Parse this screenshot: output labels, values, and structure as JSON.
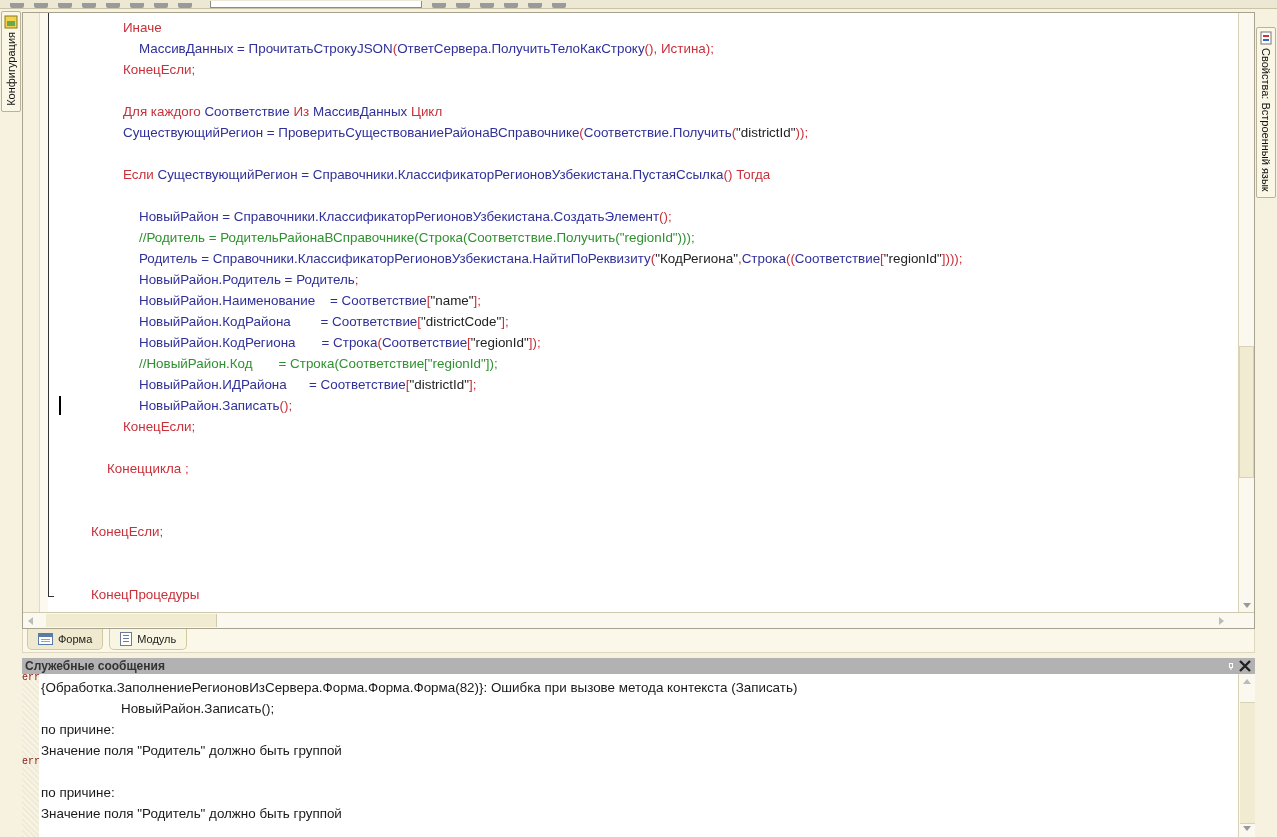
{
  "left_panel": {
    "tab": "Конфигурация"
  },
  "right_panel": {
    "tab": "Свойства: Встроенный язык"
  },
  "editor": {
    "code": [
      {
        "kind": "block",
        "children": [
          {
            "kind": "block",
            "children": [
              {
                "kind": "line",
                "tokens": [
                  {
                    "text": "Иначе",
                    "kind": "kw"
                  }
                ]
              },
              {
                "kind": "block",
                "children": [
                  {
                    "kind": "line",
                    "tokens": [
                      {
                        "text": "МассивДанных = ПрочитатьСтрокуJSON",
                        "kind": "id"
                      },
                      {
                        "text": "(",
                        "kind": "op"
                      },
                      {
                        "text": "ОтветСервера.ПолучитьТелоКакСтроку",
                        "kind": "id"
                      },
                      {
                        "text": "(), ",
                        "kind": "op"
                      },
                      {
                        "text": "Истина",
                        "kind": "kw"
                      },
                      {
                        "text": ");",
                        "kind": "op"
                      }
                    ]
                  }
                ]
              },
              {
                "kind": "line",
                "tokens": [
                  {
                    "text": "КонецЕсли;",
                    "kind": "kw"
                  }
                ]
              },
              {
                "kind": "blank"
              },
              {
                "kind": "line",
                "tokens": [
                  {
                    "text": "Для каждого ",
                    "kind": "kw"
                  },
                  {
                    "text": "Соответствие ",
                    "kind": "id"
                  },
                  {
                    "text": "Из ",
                    "kind": "kw"
                  },
                  {
                    "text": "МассивДанных ",
                    "kind": "id"
                  },
                  {
                    "text": "Цикл",
                    "kind": "kw"
                  }
                ]
              },
              {
                "kind": "line",
                "tokens": [
                  {
                    "text": "СуществующийРегион = ПроверитьСуществованиеРайонаВСправочнике",
                    "kind": "id"
                  },
                  {
                    "text": "(",
                    "kind": "op"
                  },
                  {
                    "text": "Соответствие.Получить",
                    "kind": "id"
                  },
                  {
                    "text": "(",
                    "kind": "op"
                  },
                  {
                    "text": "\"districtId\"",
                    "kind": "str"
                  },
                  {
                    "text": "));",
                    "kind": "op"
                  }
                ]
              },
              {
                "kind": "blank"
              },
              {
                "kind": "line",
                "tokens": [
                  {
                    "text": "Если ",
                    "kind": "kw"
                  },
                  {
                    "text": "СуществующийРегион = Справочники.КлассификаторРегионовУзбекистана.ПустаяСсылка",
                    "kind": "id"
                  },
                  {
                    "text": "()",
                    "kind": "op"
                  },
                  {
                    "text": " Тогда",
                    "kind": "kw"
                  }
                ]
              },
              {
                "kind": "blank"
              },
              {
                "kind": "block",
                "children": [
                  {
                    "kind": "line",
                    "tokens": [
                      {
                        "text": "НовыйРайон = Справочники.КлассификаторРегионовУзбекистана.СоздатьЭлемент",
                        "kind": "id"
                      },
                      {
                        "text": "();",
                        "kind": "op"
                      }
                    ]
                  },
                  {
                    "kind": "line",
                    "tokens": [
                      {
                        "text": "//Родитель = РодительРайонаВСправочнике(Строка(Соответствие.Получить(\"regionId\")));",
                        "kind": "cm"
                      }
                    ]
                  },
                  {
                    "kind": "line",
                    "tokens": [
                      {
                        "text": "Родитель = Справочники.КлассификаторРегионовУзбекистана.НайтиПоРеквизиту",
                        "kind": "id"
                      },
                      {
                        "text": "(",
                        "kind": "op"
                      },
                      {
                        "text": "\"КодРегиона\"",
                        "kind": "str"
                      },
                      {
                        "text": ",",
                        "kind": "op"
                      },
                      {
                        "text": "Строка",
                        "kind": "id"
                      },
                      {
                        "text": "((",
                        "kind": "op"
                      },
                      {
                        "text": "Соответствие",
                        "kind": "id"
                      },
                      {
                        "text": "[",
                        "kind": "op"
                      },
                      {
                        "text": "\"regionId\"",
                        "kind": "str"
                      },
                      {
                        "text": "])));",
                        "kind": "op"
                      }
                    ]
                  },
                  {
                    "kind": "line",
                    "tokens": [
                      {
                        "text": "НовыйРайон.Родитель = Родитель",
                        "kind": "id"
                      },
                      {
                        "text": ";",
                        "kind": "op"
                      }
                    ]
                  },
                  {
                    "kind": "line",
                    "tokens": [
                      {
                        "text": "НовыйРайон.Наименование    = Соответствие",
                        "kind": "id"
                      },
                      {
                        "text": "[",
                        "kind": "op"
                      },
                      {
                        "text": "\"name\"",
                        "kind": "str"
                      },
                      {
                        "text": "];",
                        "kind": "op"
                      }
                    ]
                  },
                  {
                    "kind": "line",
                    "tokens": [
                      {
                        "text": "НовыйРайон.КодРайона        = Соответствие",
                        "kind": "id"
                      },
                      {
                        "text": "[",
                        "kind": "op"
                      },
                      {
                        "text": "\"districtCode\"",
                        "kind": "str"
                      },
                      {
                        "text": "];",
                        "kind": "op"
                      }
                    ]
                  },
                  {
                    "kind": "line",
                    "tokens": [
                      {
                        "text": "НовыйРайон.КодРегиона       = Строка",
                        "kind": "id"
                      },
                      {
                        "text": "(",
                        "kind": "op"
                      },
                      {
                        "text": "Соответствие",
                        "kind": "id"
                      },
                      {
                        "text": "[",
                        "kind": "op"
                      },
                      {
                        "text": "\"regionId\"",
                        "kind": "str"
                      },
                      {
                        "text": "]);",
                        "kind": "op"
                      }
                    ]
                  },
                  {
                    "kind": "line",
                    "tokens": [
                      {
                        "text": "//НовыйРайон.Код       = Строка(Соответствие[\"regionId\"]);",
                        "kind": "cm"
                      }
                    ]
                  },
                  {
                    "kind": "line",
                    "tokens": [
                      {
                        "text": "НовыйРайон.ИДРайона      = Соответствие",
                        "kind": "id"
                      },
                      {
                        "text": "[",
                        "kind": "op"
                      },
                      {
                        "text": "\"districtId\"",
                        "kind": "str"
                      },
                      {
                        "text": "];",
                        "kind": "op"
                      }
                    ]
                  },
                  {
                    "kind": "line",
                    "cursor": true,
                    "tokens": [
                      {
                        "text": "НовыйРайон.Записать",
                        "kind": "id"
                      },
                      {
                        "text": "();",
                        "kind": "op"
                      }
                    ]
                  }
                ]
              },
              {
                "kind": "line",
                "tokens": [
                  {
                    "text": "КонецЕсли;",
                    "kind": "kw"
                  }
                ]
              }
            ]
          },
          {
            "kind": "blank"
          },
          {
            "kind": "line",
            "tokens": [
              {
                "text": "Конеццикла ;",
                "kind": "kw"
              }
            ]
          }
        ]
      },
      {
        "kind": "blank"
      },
      {
        "kind": "blank"
      },
      {
        "kind": "line",
        "tokens": [
          {
            "text": "КонецЕсли;",
            "kind": "kw"
          }
        ]
      },
      {
        "kind": "blank"
      },
      {
        "kind": "blank"
      },
      {
        "kind": "line",
        "tokens": [
          {
            "text": "КонецПроцедуры",
            "kind": "kw"
          }
        ]
      }
    ]
  },
  "tabs": [
    {
      "label": "Форма",
      "selected": false
    },
    {
      "label": "Модуль",
      "selected": true
    }
  ],
  "messages": {
    "title": "Служебные сообщения",
    "entries": [
      {
        "marker": "err",
        "lines": [
          {
            "kind": "text",
            "text": "{Обработка.ЗаполнениеРегионовИзСервера.Форма.Форма.Форма(82)}: Ошибка при вызове метода контекста (Записать)"
          },
          {
            "kind": "indented",
            "text": "НовыйРайон.Записать();"
          },
          {
            "kind": "text",
            "text": "по причине:"
          },
          {
            "kind": "text",
            "text": "Значение поля \"Родитель\" должно быть группой"
          }
        ]
      },
      {
        "marker": "err",
        "lines": [
          {
            "kind": "blank"
          },
          {
            "kind": "text",
            "text": "по причине:"
          },
          {
            "kind": "text",
            "text": "Значение поля \"Родитель\" должно быть группой"
          }
        ]
      }
    ]
  }
}
